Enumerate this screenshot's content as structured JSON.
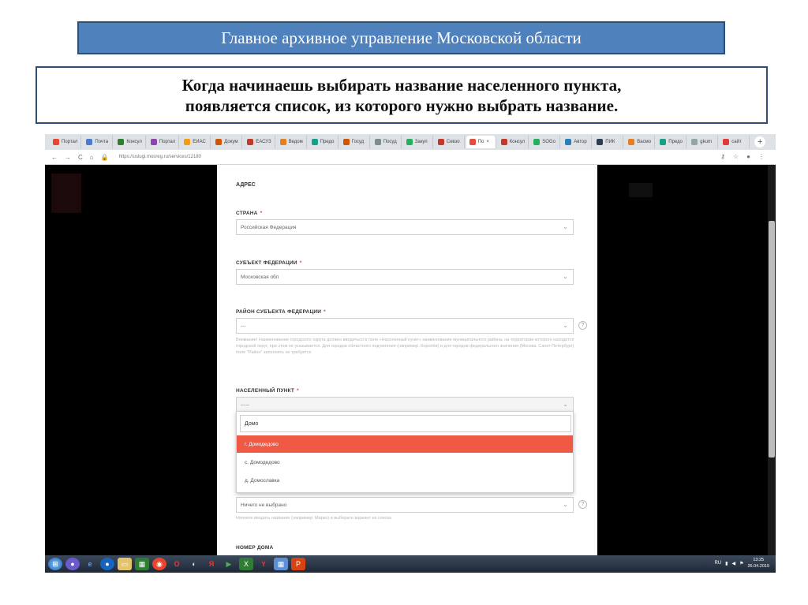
{
  "slide": {
    "title": "Главное архивное управление Московской области",
    "caption_line1": "Когда начинаешь выбирать название населенного пункта,",
    "caption_line2": "появляется список, из которого нужно выбрать название."
  },
  "browser": {
    "tabs": [
      "Портал",
      "Почта",
      "Консул",
      "Портал",
      "ЕИАС",
      "Докум",
      "ЕАСУЗ",
      "Ведом",
      "Предо",
      "Госуд",
      "Посуд",
      "Закуп",
      "Севзо",
      "По",
      "Консул",
      "SOGo",
      "Автор",
      "ПИК",
      "Bacмо",
      "Предо",
      "gkum",
      "сайт"
    ],
    "active_tab_index": 13,
    "url": "https://uslugi.mosreg.ru/services/12180"
  },
  "form": {
    "section_title": "АДРЕС",
    "country_label": "СТРАНА",
    "country_value": "Российская Федерация",
    "subject_label": "СУБЪЕКТ ФЕДЕРАЦИИ",
    "subject_value": "Московская обл",
    "district_label": "РАЙОН СУБЪЕКТА ФЕДЕРАЦИИ",
    "district_value": "---",
    "district_hint": "Внимание! Наименование городского округа должно вводиться в поле «Населенный пункт» наименование муниципального района, на территории которого находится городской округ, при этом не указывается. Для городов областного подчинения (например, Королёв) и для городов федерального значения (Москва, Санкт-Петербург) поле \"Район\" заполнять не требуется",
    "locality_label": "НАСЕЛЕННЫЙ ПУНКТ",
    "locality_value": "-----",
    "search_value": "Домо",
    "options": [
      "г. Домодедово",
      "с. Домодедово",
      "д. Домославка"
    ],
    "selected_index": 0,
    "street_value": "Ничего не выбрано",
    "street_hint": "Начните вводить название (например: Марко) и выберите вариант из списка",
    "house_label": "НОМЕР ДОМА"
  },
  "taskbar": {
    "time": "13:25",
    "date": "26.04.2019"
  }
}
